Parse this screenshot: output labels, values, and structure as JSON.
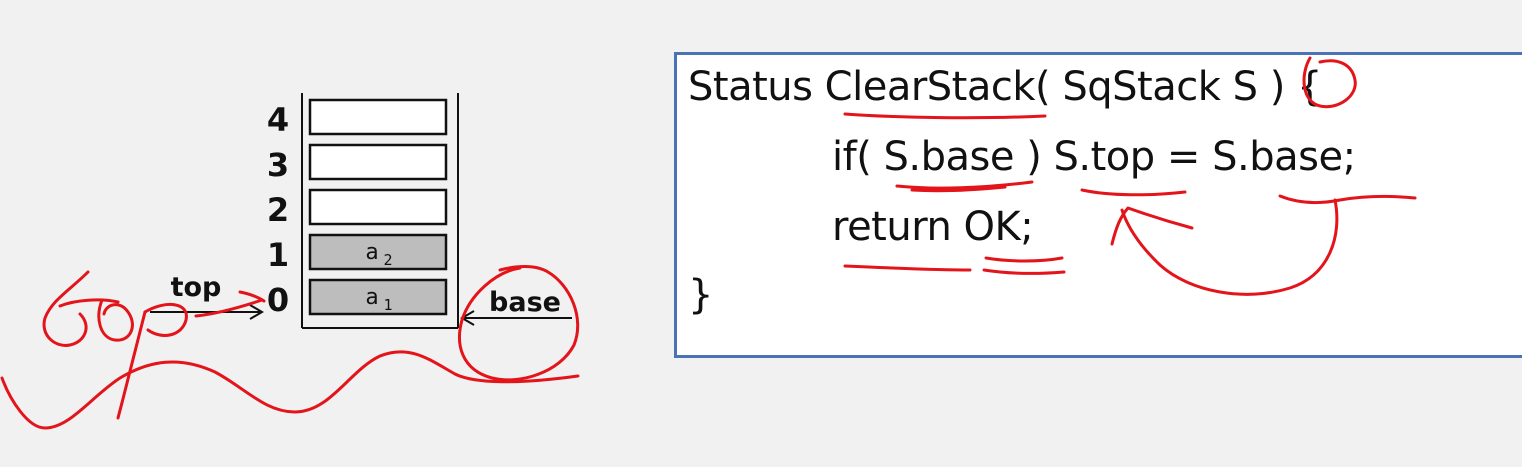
{
  "stack": {
    "indices": [
      "4",
      "3",
      "2",
      "1",
      "0"
    ],
    "cells": [
      {
        "base": "",
        "sub": "",
        "filled": false
      },
      {
        "base": "",
        "sub": "",
        "filled": false
      },
      {
        "base": "",
        "sub": "",
        "filled": false
      },
      {
        "base": "a",
        "sub": "2",
        "filled": true
      },
      {
        "base": "a",
        "sub": "1",
        "filled": true
      }
    ],
    "top_label": "top",
    "base_label": "base"
  },
  "code": {
    "lines": [
      "Status ClearStack( SqStack S ) {",
      "if( S.base ) S.top = S.base;",
      "return OK;",
      "}"
    ]
  },
  "colors": {
    "box_border": "#4a72b5",
    "annotation_ink": "#e3141a",
    "cell_filled": "#bdbdbd",
    "cell_empty": "#ffffff"
  }
}
